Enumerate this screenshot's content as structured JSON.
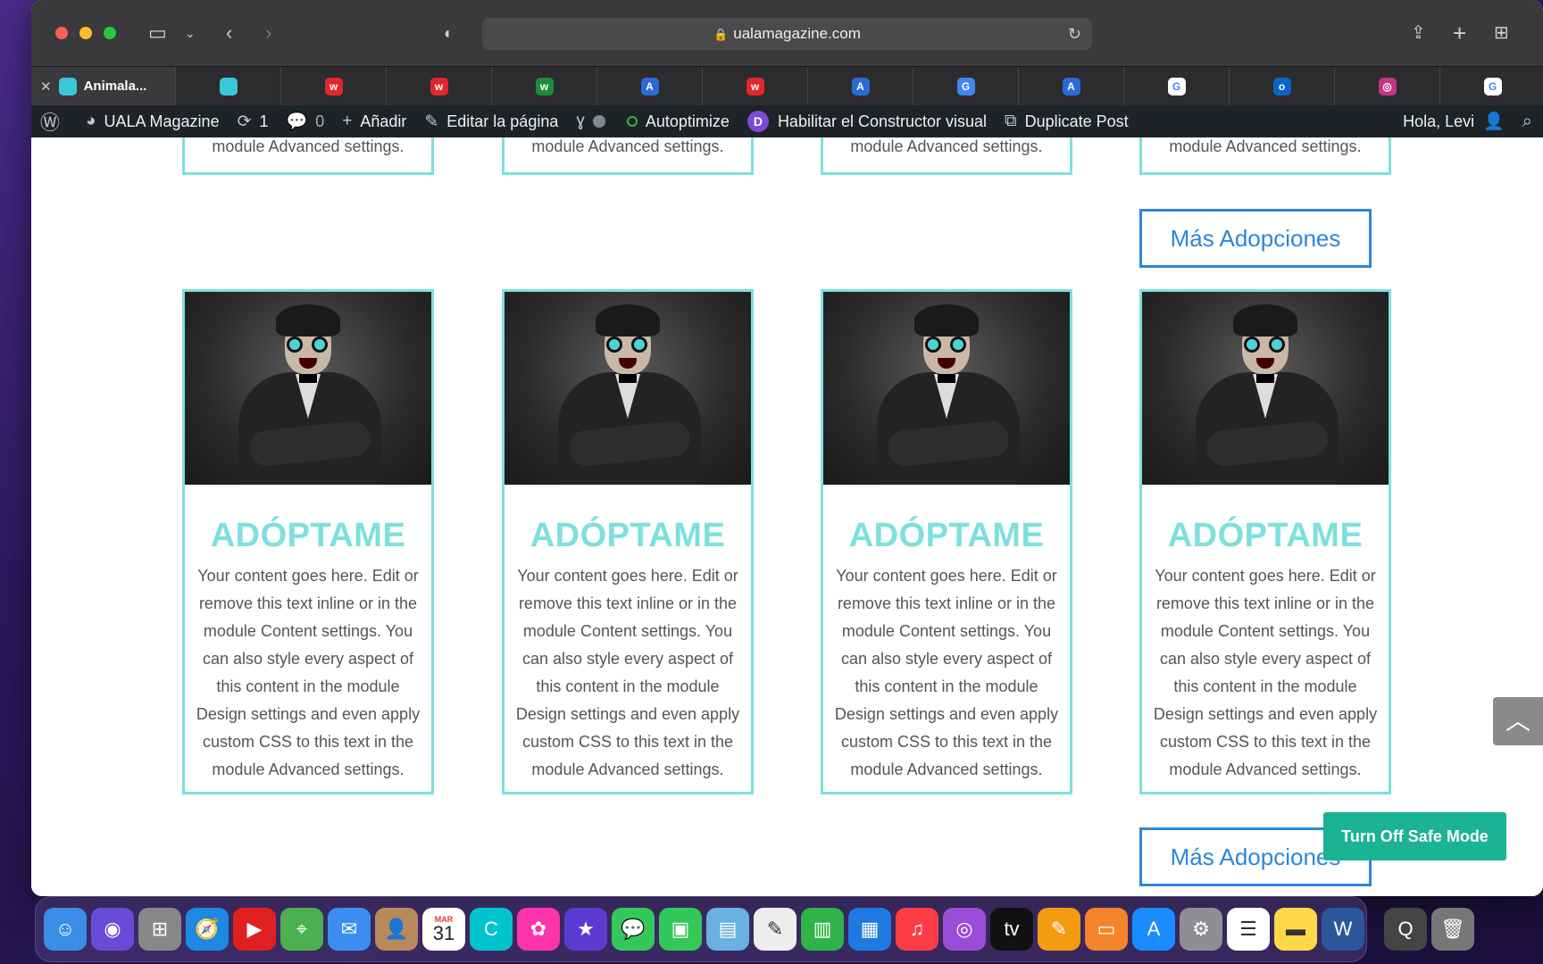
{
  "browser": {
    "url": "ualamagazine.com",
    "active_tab": "Animala...",
    "tab_favicons": [
      {
        "icon": "cyan-square",
        "label": "",
        "color": "#38c8d8"
      },
      {
        "icon": "wallapop-w",
        "label": "w",
        "color": "#e1262c"
      },
      {
        "icon": "wallapop-w",
        "label": "w",
        "color": "#e1262c"
      },
      {
        "icon": "green-w",
        "label": "w",
        "color": "#1c8c3c"
      },
      {
        "icon": "translate-a",
        "label": "A",
        "color": "#2a6ad6"
      },
      {
        "icon": "wallapop-w",
        "label": "w",
        "color": "#e1262c"
      },
      {
        "icon": "translate-a",
        "label": "A",
        "color": "#2a6ad6"
      },
      {
        "icon": "google-translate",
        "label": "G",
        "color": "#4285f4"
      },
      {
        "icon": "translate-a",
        "label": "A",
        "color": "#2a6ad6"
      },
      {
        "icon": "google-g",
        "label": "G",
        "color": "#ffffff"
      },
      {
        "icon": "outlook",
        "label": "o",
        "color": "#0a64c8"
      },
      {
        "icon": "instagram",
        "label": "◎",
        "color": "#c13584"
      },
      {
        "icon": "google-g",
        "label": "G",
        "color": "#ffffff"
      }
    ]
  },
  "wpbar": {
    "site_name": "UALA Magazine",
    "updates": "1",
    "comments": "0",
    "add": "Añadir",
    "edit": "Editar la página",
    "autoptimize": "Autoptimize",
    "divi": "Habilitar el Constructor visual",
    "duplicate": "Duplicate Post",
    "greeting": "Hola, Levi"
  },
  "top_cards_text": "module Advanced settings.",
  "more_button": "Más Adopciones",
  "cards": [
    {
      "title": "ADÓPTAME",
      "text": "Your content goes here. Edit or remove this text inline or in the module Content settings. You can also style every aspect of this content in the module Design settings and even apply custom CSS to this text in the module Advanced settings."
    },
    {
      "title": "ADÓPTAME",
      "text": "Your content goes here. Edit or remove this text inline or in the module Content settings. You can also style every aspect of this content in the module Design settings and even apply custom CSS to this text in the module Advanced settings."
    },
    {
      "title": "ADÓPTAME",
      "text": "Your content goes here. Edit or remove this text inline or in the module Content settings. You can also style every aspect of this content in the module Design settings and even apply custom CSS to this text in the module Advanced settings."
    },
    {
      "title": "ADÓPTAME",
      "text": "Your content goes here. Edit or remove this text inline or in the module Content settings. You can also style every aspect of this content in the module Design settings and even apply custom CSS to this text in the module Advanced settings."
    }
  ],
  "safe_mode": "Turn Off Safe Mode",
  "dock": {
    "calendar_month": "MAR",
    "calendar_day": "31",
    "apps": [
      "finder",
      "siri",
      "launchpad",
      "safari",
      "youtube",
      "maps",
      "mail",
      "contacts",
      "calendar",
      "canva",
      "photos",
      "imovie",
      "messages",
      "facetime",
      "preview",
      "textedit",
      "numbers",
      "keynote",
      "music",
      "podcasts",
      "tv",
      "pages",
      "books",
      "app-store",
      "system-preferences",
      "reminders",
      "notes",
      "word",
      "quicktime",
      "trash"
    ]
  },
  "colors": {
    "accent": "#7de0dc",
    "link": "#2b87da",
    "safe": "#1ab394",
    "wpbar": "#1d2327"
  }
}
